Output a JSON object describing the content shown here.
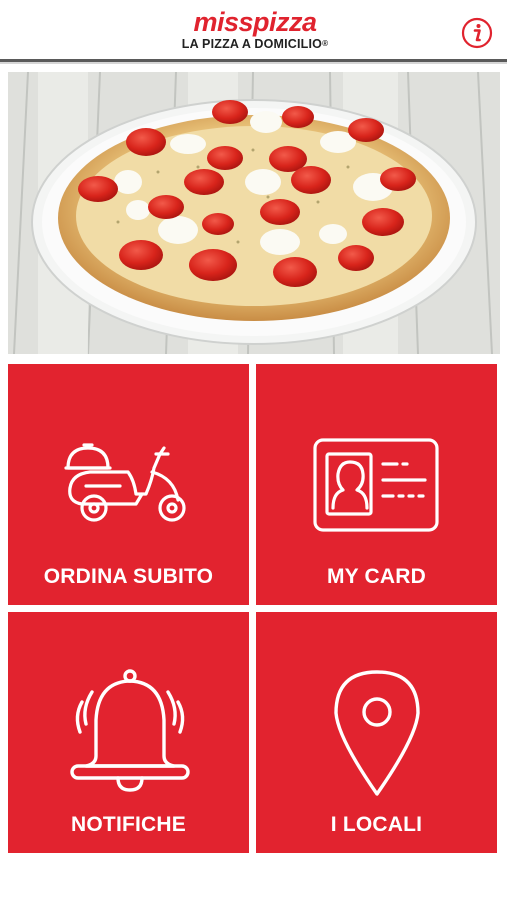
{
  "header": {
    "brand": "misspizza",
    "tagline": "LA PIZZA A DOMICILIO",
    "registered": "®",
    "info_icon": "info-icon"
  },
  "colors": {
    "brand_red": "#e2232f",
    "text_white": "#ffffff"
  },
  "tiles": [
    {
      "label": "ORDINA SUBITO",
      "icon": "scooter-icon"
    },
    {
      "label": "MY CARD",
      "icon": "id-card-icon"
    },
    {
      "label": "NOTIFICHE",
      "icon": "bell-icon"
    },
    {
      "label": "I LOCALI",
      "icon": "location-pin-icon"
    }
  ]
}
